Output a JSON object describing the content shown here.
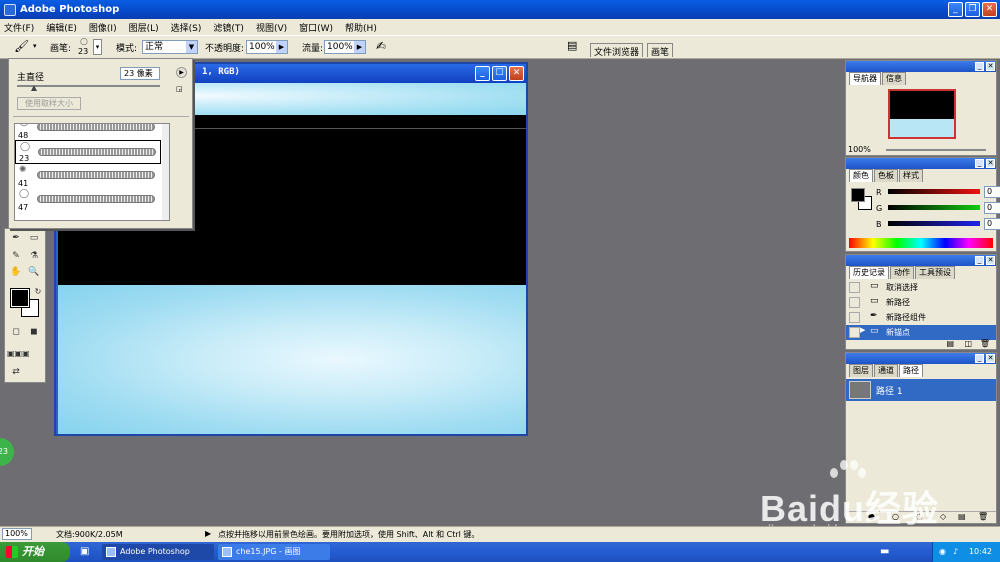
{
  "app": {
    "title": "Adobe Photoshop"
  },
  "menu": [
    "文件(F)",
    "编辑(E)",
    "图像(I)",
    "图层(L)",
    "选择(S)",
    "滤镜(T)",
    "视图(V)",
    "窗口(W)",
    "帮助(H)"
  ],
  "options": {
    "brush_label": "画笔:",
    "brush_size": "23",
    "mode_label": "模式:",
    "mode_value": "正常",
    "opacity_label": "不透明度:",
    "opacity_value": "100%",
    "flow_label": "流量:",
    "flow_value": "100%",
    "tab_file_browser": "文件浏览器",
    "tab_brushes": "画笔"
  },
  "brush_popup": {
    "diameter_label": "主直径",
    "diameter_value": "23 像素",
    "sample_size_button": "使用取样大小",
    "brushes": [
      {
        "size": "48",
        "selected": false
      },
      {
        "size": "23",
        "selected": true
      },
      {
        "size": "41",
        "selected": false
      },
      {
        "size": "47",
        "selected": false
      }
    ]
  },
  "document": {
    "title_fragment": "1, RGB)"
  },
  "navigator": {
    "tabs": [
      "导航器",
      "信息"
    ],
    "zoom": "100%"
  },
  "color_panel": {
    "tabs": [
      "颜色",
      "色板",
      "样式"
    ],
    "channels": [
      {
        "name": "R",
        "value": "0",
        "color": "#cc1a1a"
      },
      {
        "name": "G",
        "value": "0",
        "color": "#1a9a1a"
      },
      {
        "name": "B",
        "value": "0",
        "color": "#1a1aa8"
      }
    ]
  },
  "history": {
    "tabs": [
      "历史记录",
      "动作",
      "工具预设"
    ],
    "items": [
      {
        "label": "取消选择",
        "icon": "history-step-icon",
        "selected": false
      },
      {
        "label": "新路径",
        "icon": "history-step-icon",
        "selected": false
      },
      {
        "label": "新路径组件",
        "icon": "pen-icon",
        "selected": false
      },
      {
        "label": "新锚点",
        "icon": "history-step-icon",
        "selected": true
      }
    ]
  },
  "layers": {
    "tabs": [
      "图层",
      "通道",
      "路径"
    ],
    "paths": [
      "路径 1"
    ]
  },
  "status": {
    "zoom": "100%",
    "doc": "文档:900K/2.05M",
    "hint": "点按并拖移以用前景色绘画。要用附加选项，使用 Shift、Alt 和 Ctrl 键。"
  },
  "taskbar": {
    "start": "开始",
    "tasks": [
      "Adobe Photoshop",
      "che15.JPG - 画图"
    ],
    "clock": "10:42"
  },
  "badge": "23",
  "watermark": {
    "brand": "Baidu经验",
    "url": "jingyan.baidu.com"
  },
  "colors": {
    "accent": "#316ac5",
    "sky": "#a6e1f3",
    "titlebar": "#0548c8"
  }
}
